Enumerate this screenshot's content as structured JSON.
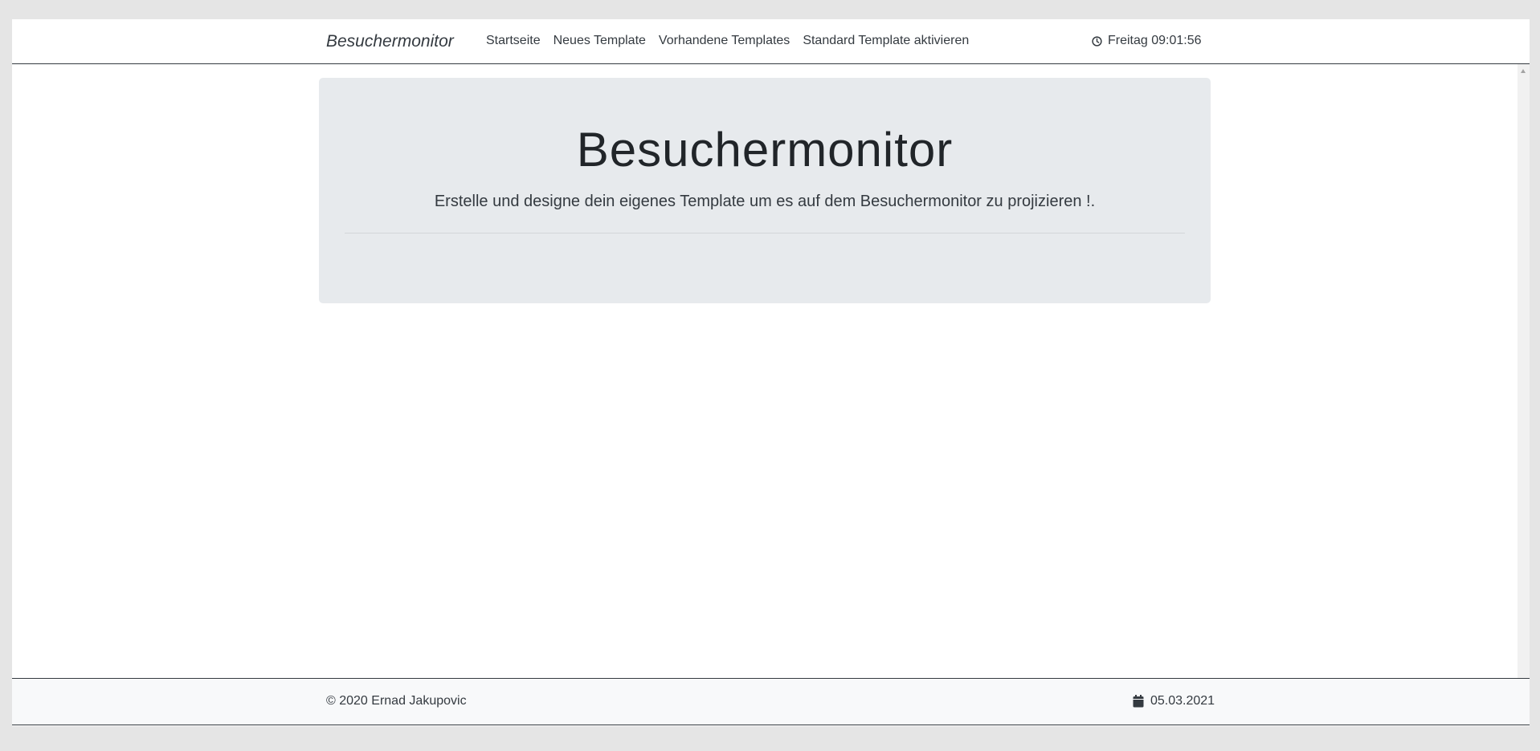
{
  "navbar": {
    "brand": "Besuchermonitor",
    "links": [
      {
        "label": "Startseite"
      },
      {
        "label": "Neues Template"
      },
      {
        "label": "Vorhandene Templates"
      },
      {
        "label": "Standard Template aktivieren"
      }
    ],
    "clock": {
      "icon": "clock-icon",
      "text": "Freitag 09:01:56"
    }
  },
  "hero": {
    "title": "Besuchermonitor",
    "lead": "Erstelle und designe dein eigenes Template um es auf dem Besuchermonitor zu projizieren !."
  },
  "footer": {
    "copyright": "© 2020 Ernad Jakupovic",
    "date": {
      "icon": "calendar-icon",
      "text": "05.03.2021"
    }
  },
  "colors": {
    "page_background": "#e5e5e5",
    "jumbotron_background": "#e7eaed",
    "footer_background": "#f8f9fa",
    "text_dark": "#343a40"
  }
}
